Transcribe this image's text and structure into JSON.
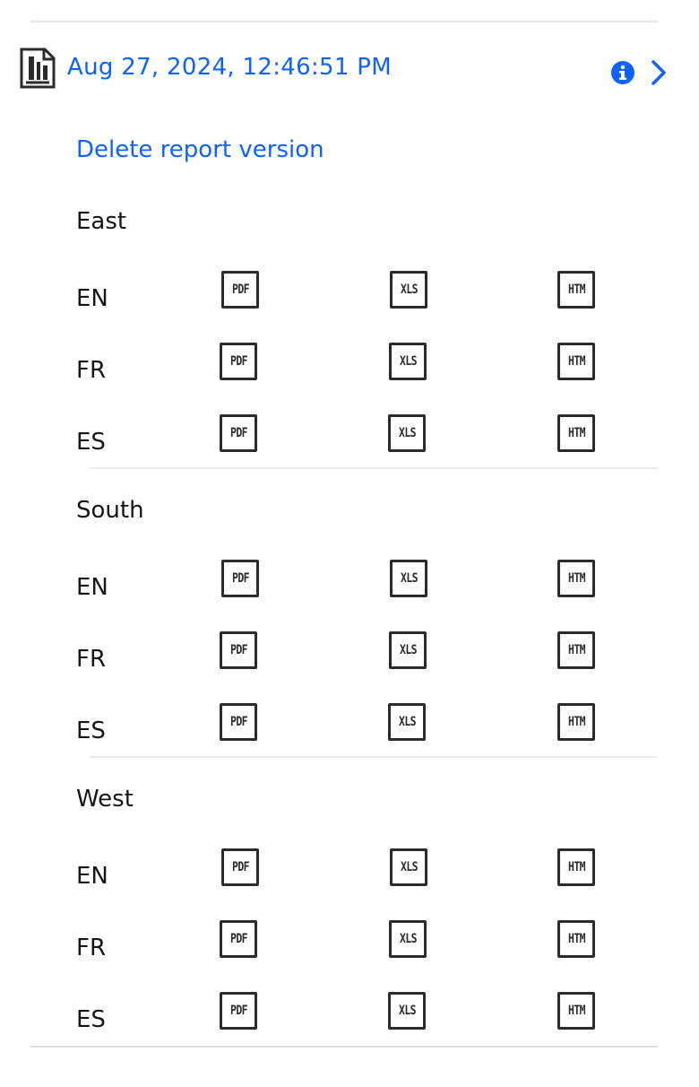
{
  "version": {
    "timestamp": "Aug 27, 2024, 12:46:51 PM",
    "icon": "report-document-icon"
  },
  "actions": {
    "delete_label": "Delete report version"
  },
  "colors": {
    "link": "#0f62fe",
    "text": "#161616",
    "icon_border": "#2b2b2b",
    "divider": "#e8e8e8"
  },
  "regions": [
    {
      "name": "East",
      "languages": [
        {
          "code": "EN",
          "formats": [
            "PDF",
            "XLS",
            "HTM"
          ]
        },
        {
          "code": "FR",
          "formats": [
            "PDF",
            "XLS",
            "HTM"
          ]
        },
        {
          "code": "ES",
          "formats": [
            "PDF",
            "XLS",
            "HTM"
          ]
        }
      ]
    },
    {
      "name": "South",
      "languages": [
        {
          "code": "EN",
          "formats": [
            "PDF",
            "XLS",
            "HTM"
          ]
        },
        {
          "code": "FR",
          "formats": [
            "PDF",
            "XLS",
            "HTM"
          ]
        },
        {
          "code": "ES",
          "formats": [
            "PDF",
            "XLS",
            "HTM"
          ]
        }
      ]
    },
    {
      "name": "West",
      "languages": [
        {
          "code": "EN",
          "formats": [
            "PDF",
            "XLS",
            "HTM"
          ]
        },
        {
          "code": "FR",
          "formats": [
            "PDF",
            "XLS",
            "HTM"
          ]
        },
        {
          "code": "ES",
          "formats": [
            "PDF",
            "XLS",
            "HTM"
          ]
        }
      ]
    }
  ]
}
